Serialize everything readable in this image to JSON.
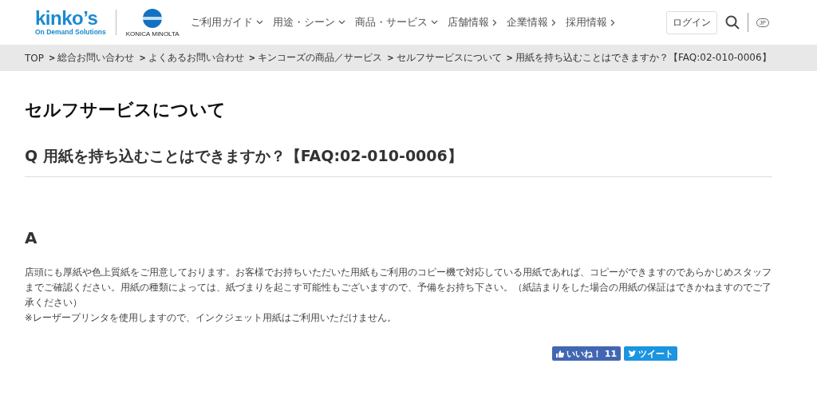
{
  "header": {
    "logo": {
      "brand": "kinko’s",
      "tagline": "On Demand Solutions",
      "partner": "KONICA MINOLTA"
    },
    "nav": [
      {
        "label": "ご利用ガイド",
        "kind": "dropdown"
      },
      {
        "label": "用途・シーン",
        "kind": "dropdown"
      },
      {
        "label": "商品・サービス",
        "kind": "dropdown"
      },
      {
        "label": "店舗情報",
        "kind": "link"
      },
      {
        "label": "企業情報",
        "kind": "link"
      },
      {
        "label": "採用情報",
        "kind": "link"
      }
    ],
    "login": "ログイン",
    "language": "JP"
  },
  "breadcrumb": {
    "separator": ">",
    "items": [
      "TOP",
      "総合お問い合わせ",
      "よくあるお問い合わせ",
      "キンコーズの商品／サービス",
      "セルフサービスについて",
      "用紙を持ち込むことはできますか？【FAQ:02-010-0006】"
    ]
  },
  "category_title": "セルフサービスについて",
  "question": "Q 用紙を持ち込むことはできますか？【FAQ:02-010-0006】",
  "answer_label": "A",
  "answer_paragraphs": [
    "店頭にも厚紙や色上質紙をご用意しております。お客様でお持ちいただいた用紙もご利用のコピー機で対応している用紙であれば、コピーができますのであらかじめスタッフまでご確認ください。用紙の種類によっては、紙づまりを起こす可能性もございますので、予備をお持ち下さい。（紙詰まりをした場合の用紙の保証はできかねますのでご了承ください）",
    "※レーザープリンタを使用しますので、インクジェット用紙はご利用いただけません。"
  ],
  "social": {
    "like": "いいね！",
    "like_count": "11",
    "tweet": "ツイート"
  }
}
